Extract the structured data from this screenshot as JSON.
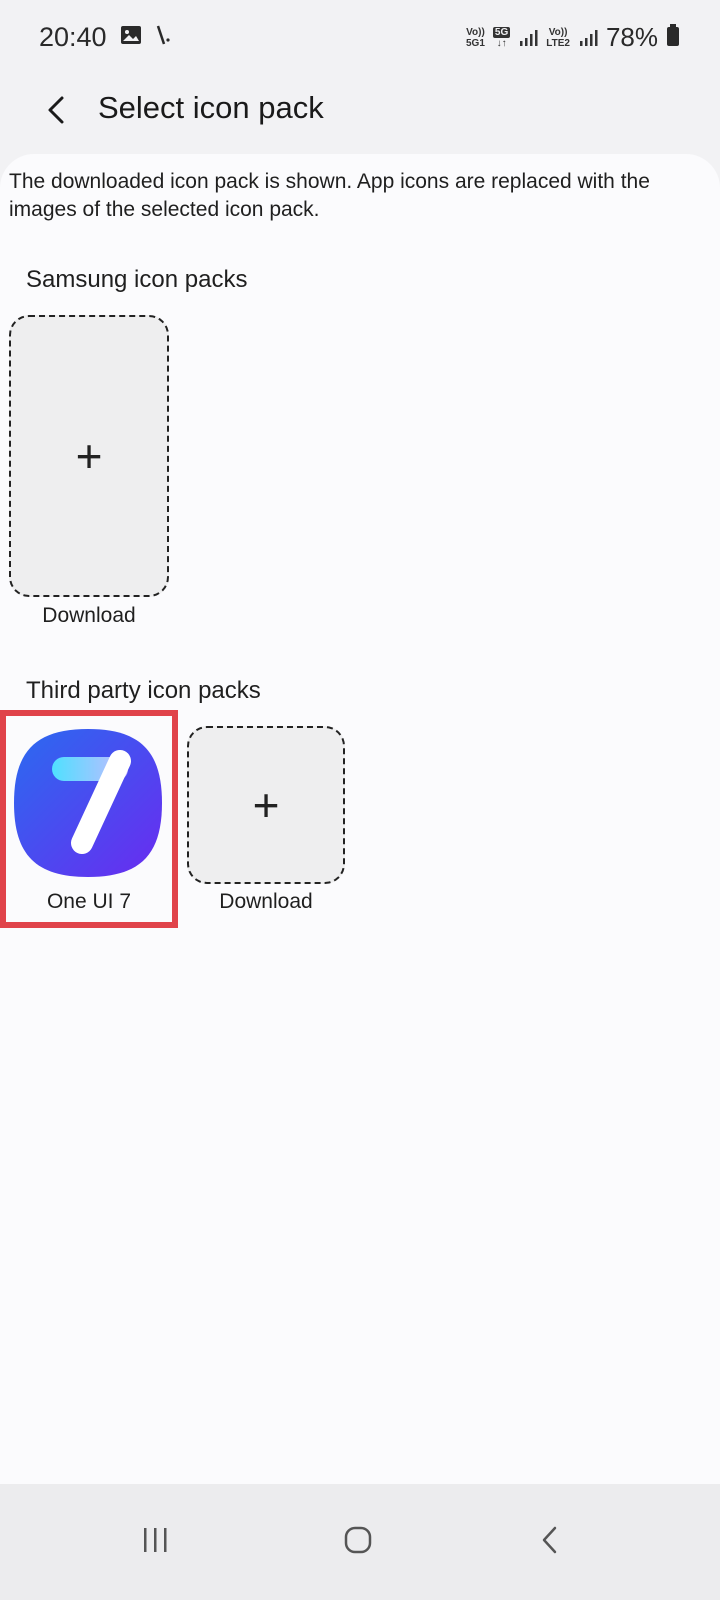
{
  "status_bar": {
    "time": "20:40",
    "sim1_label_top": "Vo))",
    "sim1_label_bottom": "5G1",
    "net_type": "5G",
    "sim2_label_top": "Vo))",
    "sim2_label_bottom": "LTE2",
    "battery": "78%"
  },
  "header": {
    "title": "Select icon pack"
  },
  "description": "The downloaded icon pack is shown. App icons are replaced with the images of the selected icon pack.",
  "samsung_section": {
    "title": "Samsung icon packs",
    "download_label": "Download"
  },
  "third_party_section": {
    "title": "Third party icon packs",
    "selected_pack_name": "One UI 7",
    "download_label": "Download"
  },
  "colors": {
    "highlight": "#e0434a",
    "icon_gradient_start": "#2a6bf0",
    "icon_gradient_end": "#6a2bf0"
  }
}
